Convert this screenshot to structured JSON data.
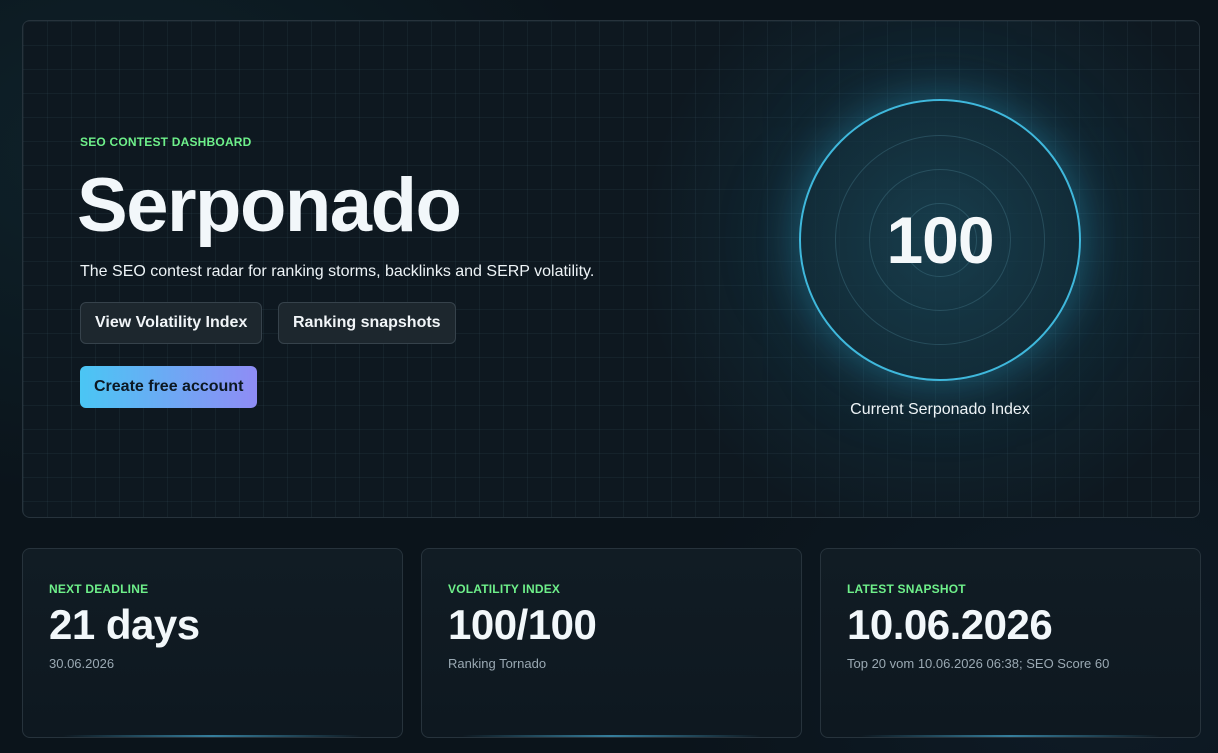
{
  "hero": {
    "eyebrow": "SEO CONTEST DASHBOARD",
    "title": "Serponado",
    "subtitle": "The SEO contest radar for ranking storms, backlinks and SERP volatility.",
    "buttons": {
      "volatility": "View Volatility Index",
      "snapshots": "Ranking snapshots",
      "create": "Create free account"
    },
    "radar": {
      "value": "100",
      "caption": "Current Serponado Index"
    }
  },
  "cards": [
    {
      "label": "NEXT DEADLINE",
      "value": "21 days",
      "sub": "30.06.2026"
    },
    {
      "label": "VOLATILITY INDEX",
      "value": "100/100",
      "sub": "Ranking Tornado"
    },
    {
      "label": "LATEST SNAPSHOT",
      "value": "10.06.2026",
      "sub": "Top 20 vom 10.06.2026 06:38; SEO Score 60"
    }
  ],
  "colors": {
    "accent_green": "#6ef08a",
    "radar_ring": "#3fb8dc",
    "gradient_start": "#4ac6f4",
    "gradient_end": "#8f8cf5",
    "background": "#0b141b"
  }
}
